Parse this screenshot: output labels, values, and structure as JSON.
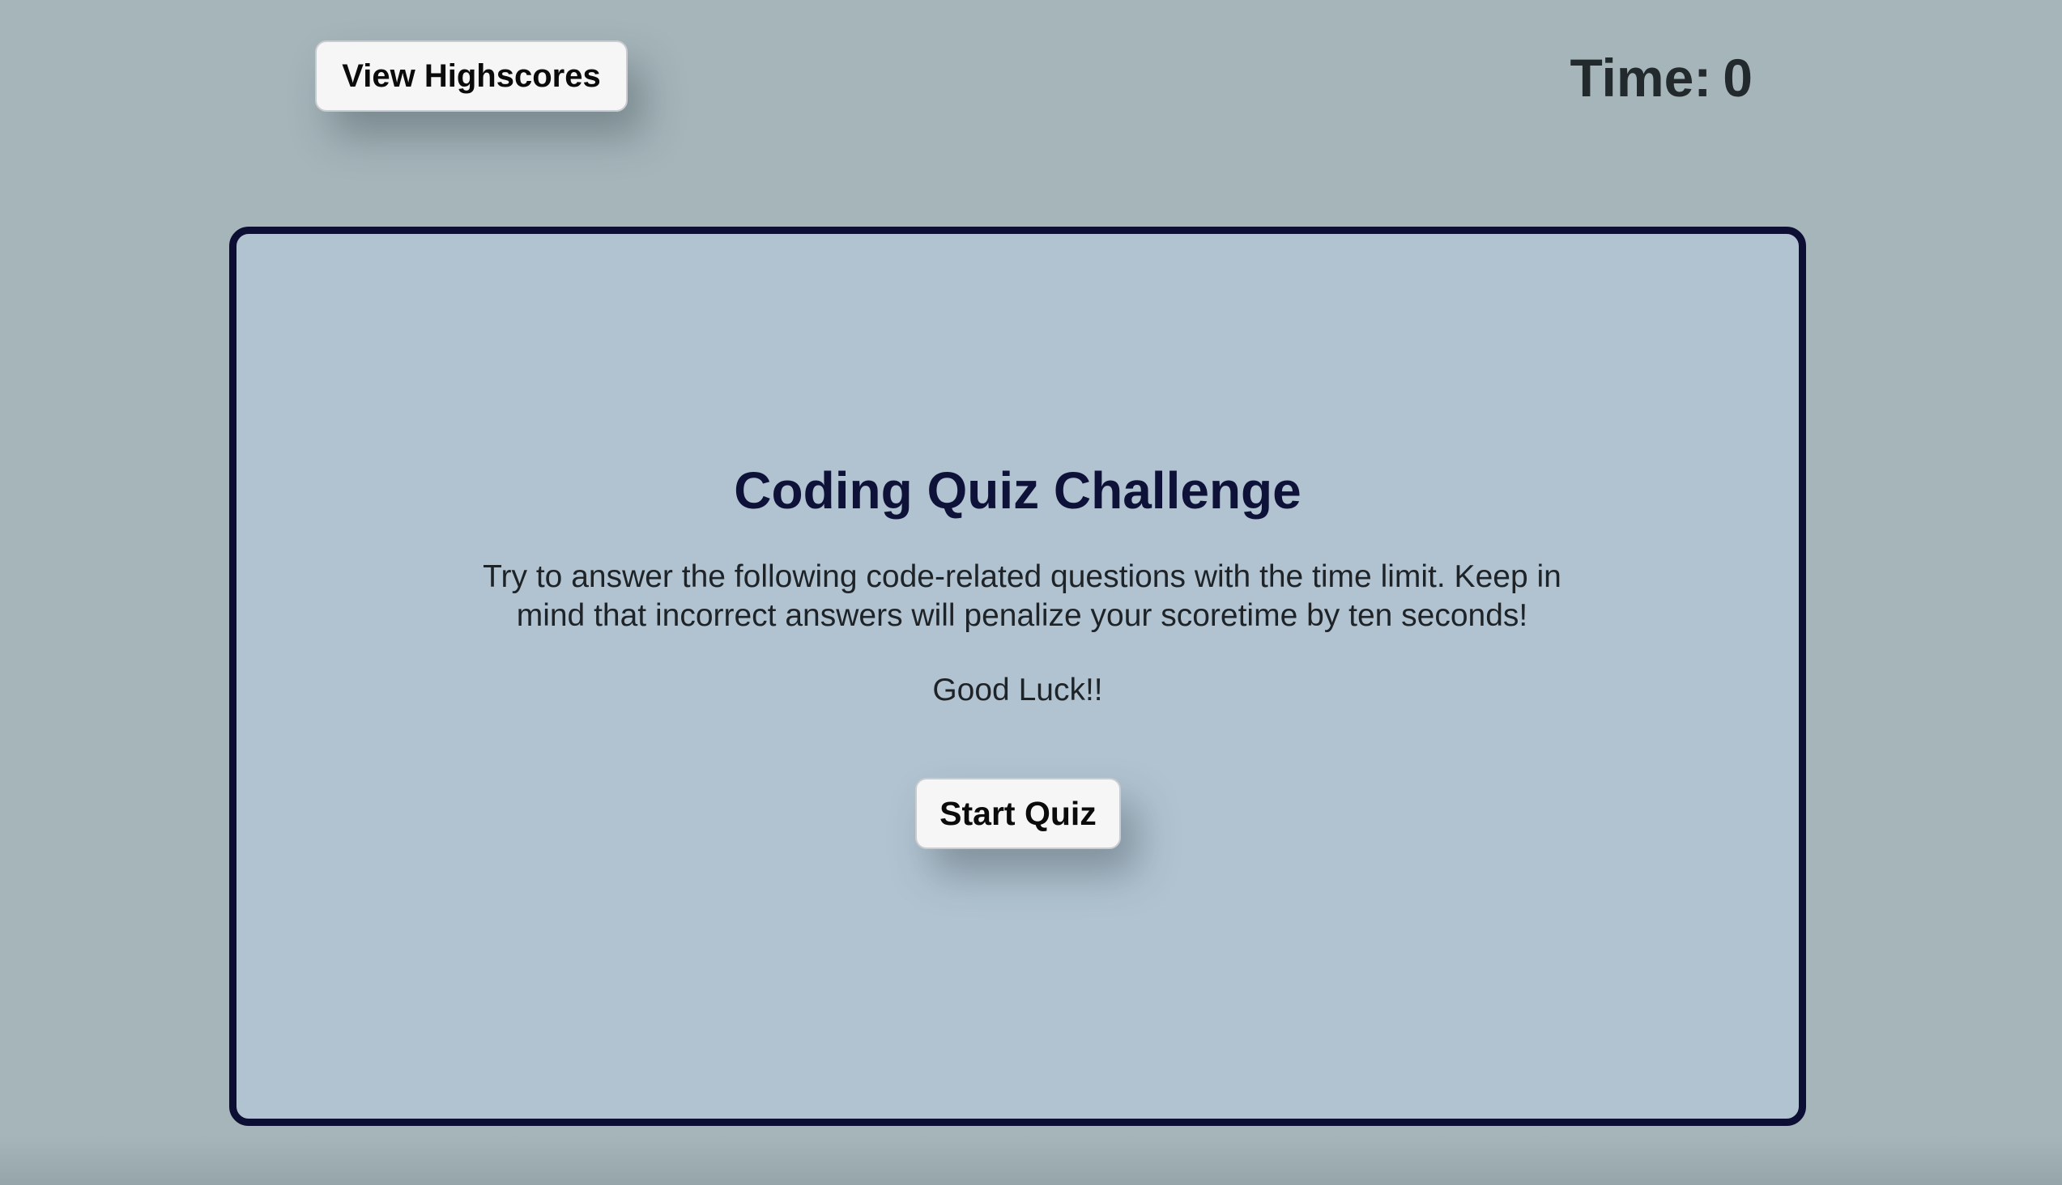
{
  "header": {
    "highscores_label": "View Highscores",
    "timer_label": "Time:",
    "timer_value": "0"
  },
  "quiz": {
    "title": "Coding Quiz Challenge",
    "description": "Try to answer the following code-related questions with the time limit. Keep in mind that incorrect answers will penalize your scoretime by ten seconds!",
    "luck_text": "Good Luck!!",
    "start_label": "Start Quiz"
  },
  "colors": {
    "page_background": "#a5b5ba",
    "card_background": "#b1c3d1",
    "card_border": "#0c0f33",
    "title_color": "#0e1238",
    "button_background": "#f6f6f7"
  }
}
